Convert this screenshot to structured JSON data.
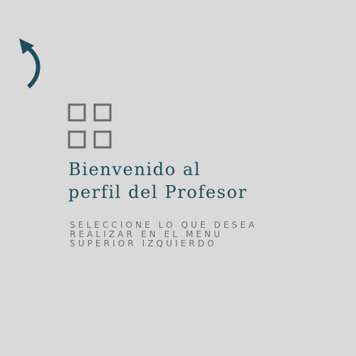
{
  "menu_hint": {
    "icon": "curved-arrow-up-left-icon",
    "color": "#1f4d5c"
  },
  "grid_icon": {
    "icon": "grid-menu-icon",
    "color": "#6b6b6b"
  },
  "welcome": {
    "line1": "Bienvenido al",
    "line2": "perfil del Profesor",
    "color": "#1f4d5c"
  },
  "instruction": {
    "line1": "SELECCIONE LO QUE DESEA",
    "line2": "REALIZAR EN EL MENU",
    "line3": "SUPERIOR IZQUIERDO",
    "color": "#6e6e6e"
  },
  "background": "#d9d9d9"
}
